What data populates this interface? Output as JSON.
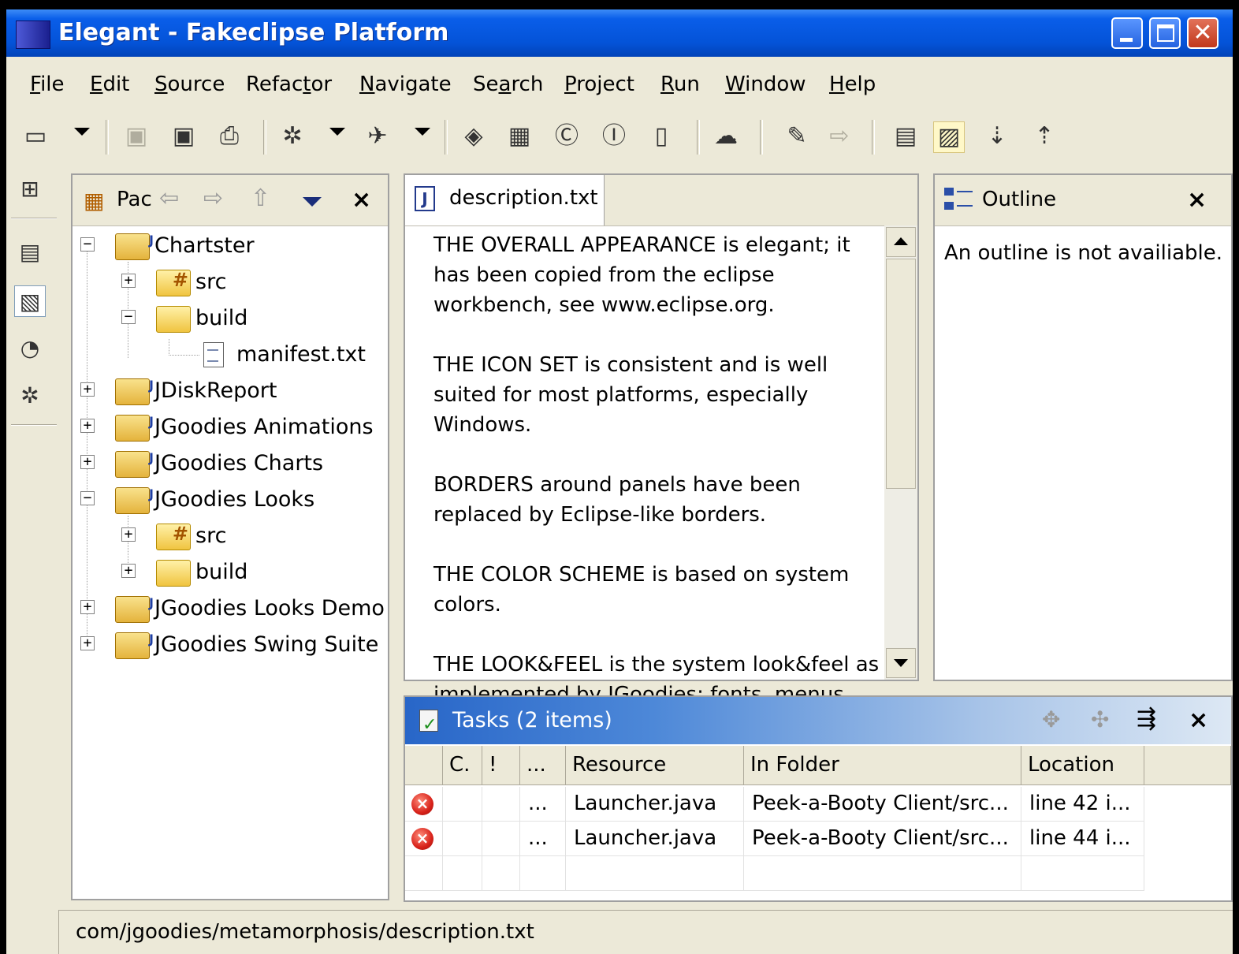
{
  "window": {
    "title": "Elegant - Fakeclipse Platform"
  },
  "menu": [
    {
      "pre": "",
      "u": "F",
      "post": "ile"
    },
    {
      "pre": "",
      "u": "E",
      "post": "dit"
    },
    {
      "pre": "",
      "u": "S",
      "post": "ource"
    },
    {
      "pre": "Refac",
      "u": "t",
      "post": "or"
    },
    {
      "pre": "",
      "u": "N",
      "post": "avigate"
    },
    {
      "pre": "Se",
      "u": "a",
      "post": "rch"
    },
    {
      "pre": "",
      "u": "P",
      "post": "roject"
    },
    {
      "pre": "",
      "u": "R",
      "post": "un"
    },
    {
      "pre": "",
      "u": "W",
      "post": "indow"
    },
    {
      "pre": "",
      "u": "H",
      "post": "elp"
    }
  ],
  "toolbar_icons": [
    "new-wizard-icon",
    "save-icon",
    "save-all-icon",
    "print-icon",
    "debug-icon",
    "run-icon",
    "new-java-project-icon",
    "new-package-icon",
    "new-class-icon",
    "new-interface-icon",
    "new-scrapbook-icon",
    "search-icon",
    "pencil-icon",
    "open-type-icon",
    "outline-icon",
    "hierarchy-icon",
    "next-annotation-icon",
    "previous-annotation-icon"
  ],
  "packages": {
    "title": "Pac",
    "tree": [
      {
        "label": "Chartster",
        "expander": "−",
        "kind": "project"
      },
      {
        "label": "src",
        "expander": "+",
        "kind": "src"
      },
      {
        "label": "build",
        "expander": "−",
        "kind": "folder"
      },
      {
        "label": "manifest.txt",
        "expander": "",
        "kind": "file"
      },
      {
        "label": "JDiskReport",
        "expander": "+",
        "kind": "project"
      },
      {
        "label": "JGoodies Animations",
        "expander": "+",
        "kind": "project"
      },
      {
        "label": "JGoodies Charts",
        "expander": "+",
        "kind": "project"
      },
      {
        "label": "JGoodies Looks",
        "expander": "−",
        "kind": "project"
      },
      {
        "label": "src",
        "expander": "+",
        "kind": "src"
      },
      {
        "label": "build",
        "expander": "+",
        "kind": "folder"
      },
      {
        "label": "JGoodies Looks Demo",
        "expander": "+",
        "kind": "project"
      },
      {
        "label": "JGoodies Swing Suite",
        "expander": "+",
        "kind": "project"
      }
    ]
  },
  "editor": {
    "tab": "description.txt",
    "paragraphs": [
      "THE OVERALL APPEARANCE is elegant; it has been copied from the eclipse workbench, see www.eclipse.org.",
      "THE ICON SET is consistent and is well suited for most platforms, especially Windows.",
      "BORDERS around panels have been replaced by Eclipse-like borders.",
      "THE COLOR SCHEME is based on system colors.",
      "THE LOOK&FEEL is the system look&feel as implemented by JGoodies; fonts, menus,"
    ]
  },
  "outline": {
    "title": "Outline",
    "message": "An outline is not availiable."
  },
  "tasks": {
    "title": "Tasks (2 items)",
    "columns": [
      "C.",
      "!",
      "...",
      "Resource",
      "In Folder",
      "Location"
    ],
    "rows": [
      {
        "more": "...",
        "resource": "Launcher.java",
        "folder": "Peek-a-Booty Client/src...",
        "location": "line 42 i..."
      },
      {
        "more": "...",
        "resource": "Launcher.java",
        "folder": "Peek-a-Booty Client/src...",
        "location": "line 44 i..."
      }
    ]
  },
  "status": {
    "path": "com/jgoodies/metamorphosis/description.txt"
  }
}
